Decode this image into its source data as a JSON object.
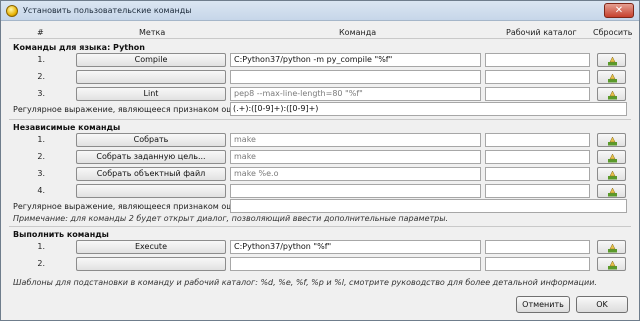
{
  "window": {
    "title": "Установить пользовательские команды",
    "close_glyph": "✕"
  },
  "columns": {
    "index": "#",
    "label": "Метка",
    "command": "Команда",
    "workdir": "Рабочий каталог",
    "reset": "Сбросить"
  },
  "python": {
    "section": "Команды для языка: Python",
    "rows": [
      {
        "index": "1.",
        "label": "Compile",
        "command": "C:Python37/python -m py_compile \"%f\"",
        "placeholder": false
      },
      {
        "index": "2.",
        "label": "",
        "command": "",
        "placeholder": false
      },
      {
        "index": "3.",
        "label": "Lint",
        "command": "pep8 --max-line-length=80 \"%f\"",
        "placeholder": true
      }
    ],
    "regex_label": "Регулярное выражение, являющееся признаком ошибки:",
    "regex_value": "(.+):([0-9]+):([0-9]+)"
  },
  "independent": {
    "section": "Независимые команды",
    "rows": [
      {
        "index": "1.",
        "label": "Собрать",
        "command": "make",
        "placeholder": true
      },
      {
        "index": "2.",
        "label": "Собрать заданную цель...",
        "command": "make",
        "placeholder": true
      },
      {
        "index": "3.",
        "label": "Собрать объектный файл",
        "command": "make %e.o",
        "placeholder": true
      },
      {
        "index": "4.",
        "label": "",
        "command": "",
        "placeholder": false
      }
    ],
    "regex_label": "Регулярное выражение, являющееся признаком ошибки:",
    "regex_value": "",
    "note": "Примечание: для команды 2 будет открыт диалог, позволяющий ввести дополнительные параметры."
  },
  "execute": {
    "section": "Выполнить команды",
    "rows": [
      {
        "index": "1.",
        "label": "Execute",
        "command": "C:Python37/python \"%f\"",
        "placeholder": false
      },
      {
        "index": "2.",
        "label": "",
        "command": "",
        "placeholder": false
      }
    ]
  },
  "footer_note": "Шаблоны для подстановки в команду и рабочий каталог: %d, %e, %f, %p и %l, смотрите руководство для более детальной информации.",
  "buttons": {
    "cancel": "Отменить",
    "ok": "OK"
  },
  "icons": {
    "reset": "clear-broom-icon",
    "app": "geany-app-icon"
  },
  "colors": {
    "icon_green": "#5a9a2a",
    "icon_yellow": "#e8c24a"
  }
}
